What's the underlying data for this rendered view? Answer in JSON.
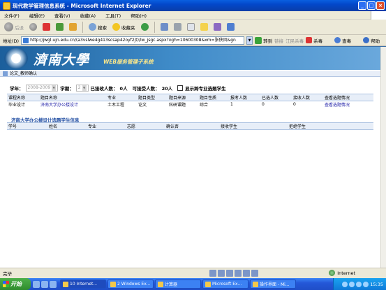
{
  "window": {
    "title": "现代教学管理信息系统 - Microsoft Internet Explorer"
  },
  "menu": [
    "文件(F)",
    "编辑(E)",
    "查看(V)",
    "收藏(A)",
    "工具(T)",
    "帮助(H)"
  ],
  "toolbar": {
    "back": "后退",
    "search": "搜索",
    "favorites": "收藏夹"
  },
  "address": {
    "label": "地址(D)",
    "url": "http://jwgl.ujn.edu.cn/(a3vslwe4g413scsap42oyf2jt)/lw_jsgc.aspx?xgh=10600308&xm=张侠凤&gn",
    "go": "转到",
    "links": "链接",
    "links2": "江民杀毒",
    "antivirus": "杀毒",
    "lookup": "查毒",
    "help": "帮助"
  },
  "banner": {
    "school": "濟南大學",
    "system": "WEB服务管理子系统"
  },
  "breadcrumb": "论文_教师确认",
  "filter": {
    "year_label": "学年：",
    "year_value": "2008-2009",
    "term_label": "学期：",
    "term_value": "2",
    "accepted_label": "已接收人数：",
    "accepted_value": "0人",
    "capacity_label": "可接受人数：",
    "capacity_value": "20人",
    "cross_major_label": "显示跨专业选题学生"
  },
  "topics_table": {
    "headers": [
      "课程名称",
      "题目名称",
      "专业",
      "题目类型",
      "题目来源",
      "题目性质",
      "报考人数",
      "已选人数",
      "接收人数",
      "查看选题情况"
    ],
    "rows": [
      [
        "毕业设计",
        "济南大学办公楼设计",
        "土木工程",
        "论文",
        "科研课题",
        "综合",
        "1",
        "0",
        "0",
        "查看选题情况"
      ]
    ]
  },
  "students_section": {
    "title": "济南大学办公楼设计选题学生信息",
    "headers": [
      "学号",
      "姓名",
      "专业",
      "志愿",
      "确认否",
      "接收学生",
      "拒绝学生"
    ]
  },
  "status": {
    "text": "完毕",
    "zone": "Internet"
  },
  "taskbar": {
    "start": "开始",
    "tasks": [
      "10 Internet...",
      "2 Windows Ex...",
      "计算器",
      "Microsoft Ex...",
      "操作界面 - Mi..."
    ],
    "active_index": 0,
    "clock": "15:35"
  }
}
